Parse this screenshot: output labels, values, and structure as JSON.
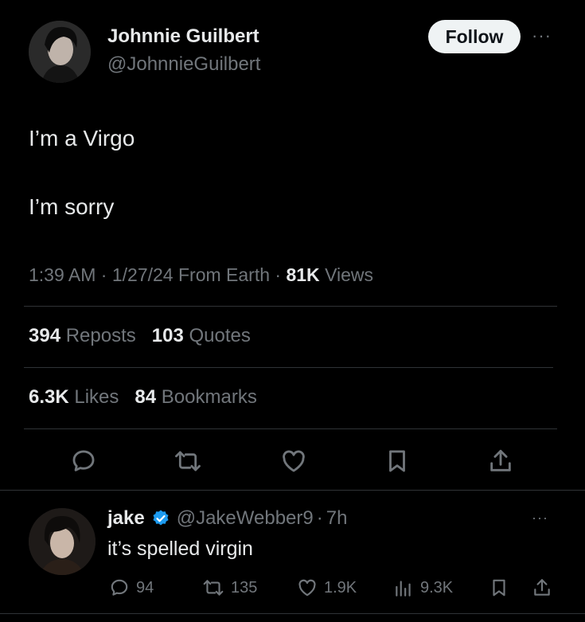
{
  "tweet": {
    "author_name": "Johnnie Guilbert",
    "author_handle": "@JohnnieGuilbert",
    "follow_label": "Follow",
    "more_label": "···",
    "lines": [
      "I’m a Virgo",
      "I’m sorry"
    ],
    "time": "1:39 AM",
    "date": "1/27/24",
    "source": "From Earth",
    "views_count": "81K",
    "views_label": "Views",
    "reposts_count": "394",
    "reposts_label": "Reposts",
    "quotes_count": "103",
    "quotes_label": "Quotes",
    "likes_count": "6.3K",
    "likes_label": "Likes",
    "bookmarks_count": "84",
    "bookmarks_label": "Bookmarks"
  },
  "reply": {
    "author_name": "jake",
    "author_handle": "@JakeWebber9",
    "age": "7h",
    "text": "it’s spelled virgin",
    "more_label": "···",
    "replies": "94",
    "reposts": "135",
    "likes": "1.9K",
    "views": "9.3K"
  },
  "colors": {
    "background": "#000000",
    "text": "#e7e9ea",
    "muted": "#71767b",
    "verified": "#1d9bf0"
  }
}
